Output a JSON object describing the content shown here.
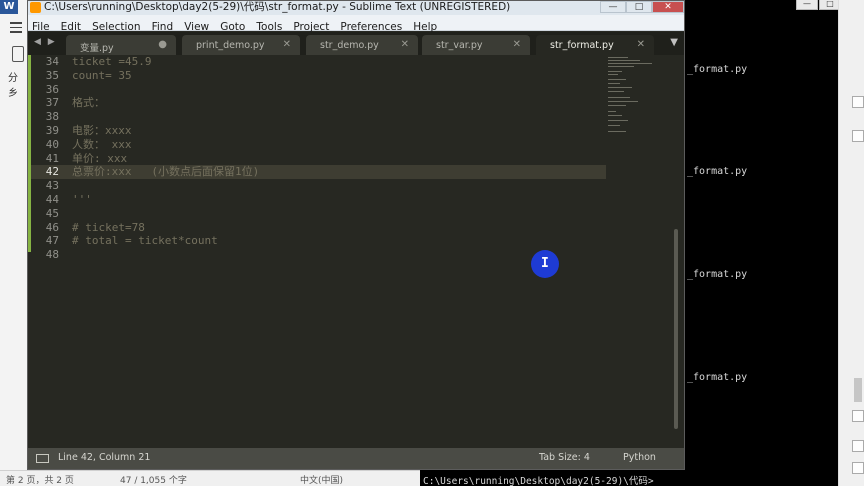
{
  "background": {
    "left_panel": {
      "app_icon": "W",
      "split_label": "分乡"
    },
    "terminal": {
      "lines": [
        "_format.py",
        "_format.py",
        "_format.py",
        "_format.py"
      ],
      "prompt": "C:\\Users\\running\\Desktop\\day2(5-29)\\代码>"
    },
    "bottom_strip": [
      "第 2 页，共 2 页",
      "47 / 1,055 个字",
      "中文(中国)"
    ]
  },
  "window": {
    "title": "C:\\Users\\running\\Desktop\\day2(5-29)\\代码\\str_format.py - Sublime Text (UNREGISTERED)",
    "controls": {
      "minimize": "—",
      "maximize": "□",
      "close": "✕"
    }
  },
  "menu": [
    "File",
    "Edit",
    "Selection",
    "Find",
    "View",
    "Goto",
    "Tools",
    "Project",
    "Preferences",
    "Help"
  ],
  "tabs": [
    {
      "label": "变量.py",
      "close": "●",
      "active": false
    },
    {
      "label": "print_demo.py",
      "close": "✕",
      "active": false
    },
    {
      "label": "str_demo.py",
      "close": "✕",
      "active": false
    },
    {
      "label": "str_var.py",
      "close": "✕",
      "active": false
    },
    {
      "label": "str_format.py",
      "close": "✕",
      "active": true
    }
  ],
  "tab_nav": "◀ ▶",
  "tab_overflow": "▼",
  "editor": {
    "lines": [
      {
        "num": "34",
        "text": "ticket =45.9"
      },
      {
        "num": "35",
        "text": "count= 35"
      },
      {
        "num": "36",
        "text": ""
      },
      {
        "num": "37",
        "text": "格式："
      },
      {
        "num": "38",
        "text": ""
      },
      {
        "num": "39",
        "text": "电影：xxxx"
      },
      {
        "num": "40",
        "text": "人数： xxx"
      },
      {
        "num": "41",
        "text": "单价: xxx"
      },
      {
        "num": "42",
        "text": "总票价:xxx   (小数点后面保留1位)"
      },
      {
        "num": "43",
        "text": ""
      },
      {
        "num": "44",
        "text": "'''"
      },
      {
        "num": "45",
        "text": ""
      },
      {
        "num": "46",
        "text": "# ticket=78"
      },
      {
        "num": "47",
        "text": "# total = ticket*count"
      },
      {
        "num": "48",
        "text": ""
      }
    ],
    "current_line": "42",
    "cursor_glyph": "I"
  },
  "status": {
    "position": "Line 42, Column 21",
    "tab_size": "Tab Size: 4",
    "syntax": "Python"
  },
  "colors": {
    "editor_bg": "#272822",
    "comment": "#75715e",
    "modified_gutter": "#86b343",
    "cursor_highlight": "#1e3bd4"
  }
}
